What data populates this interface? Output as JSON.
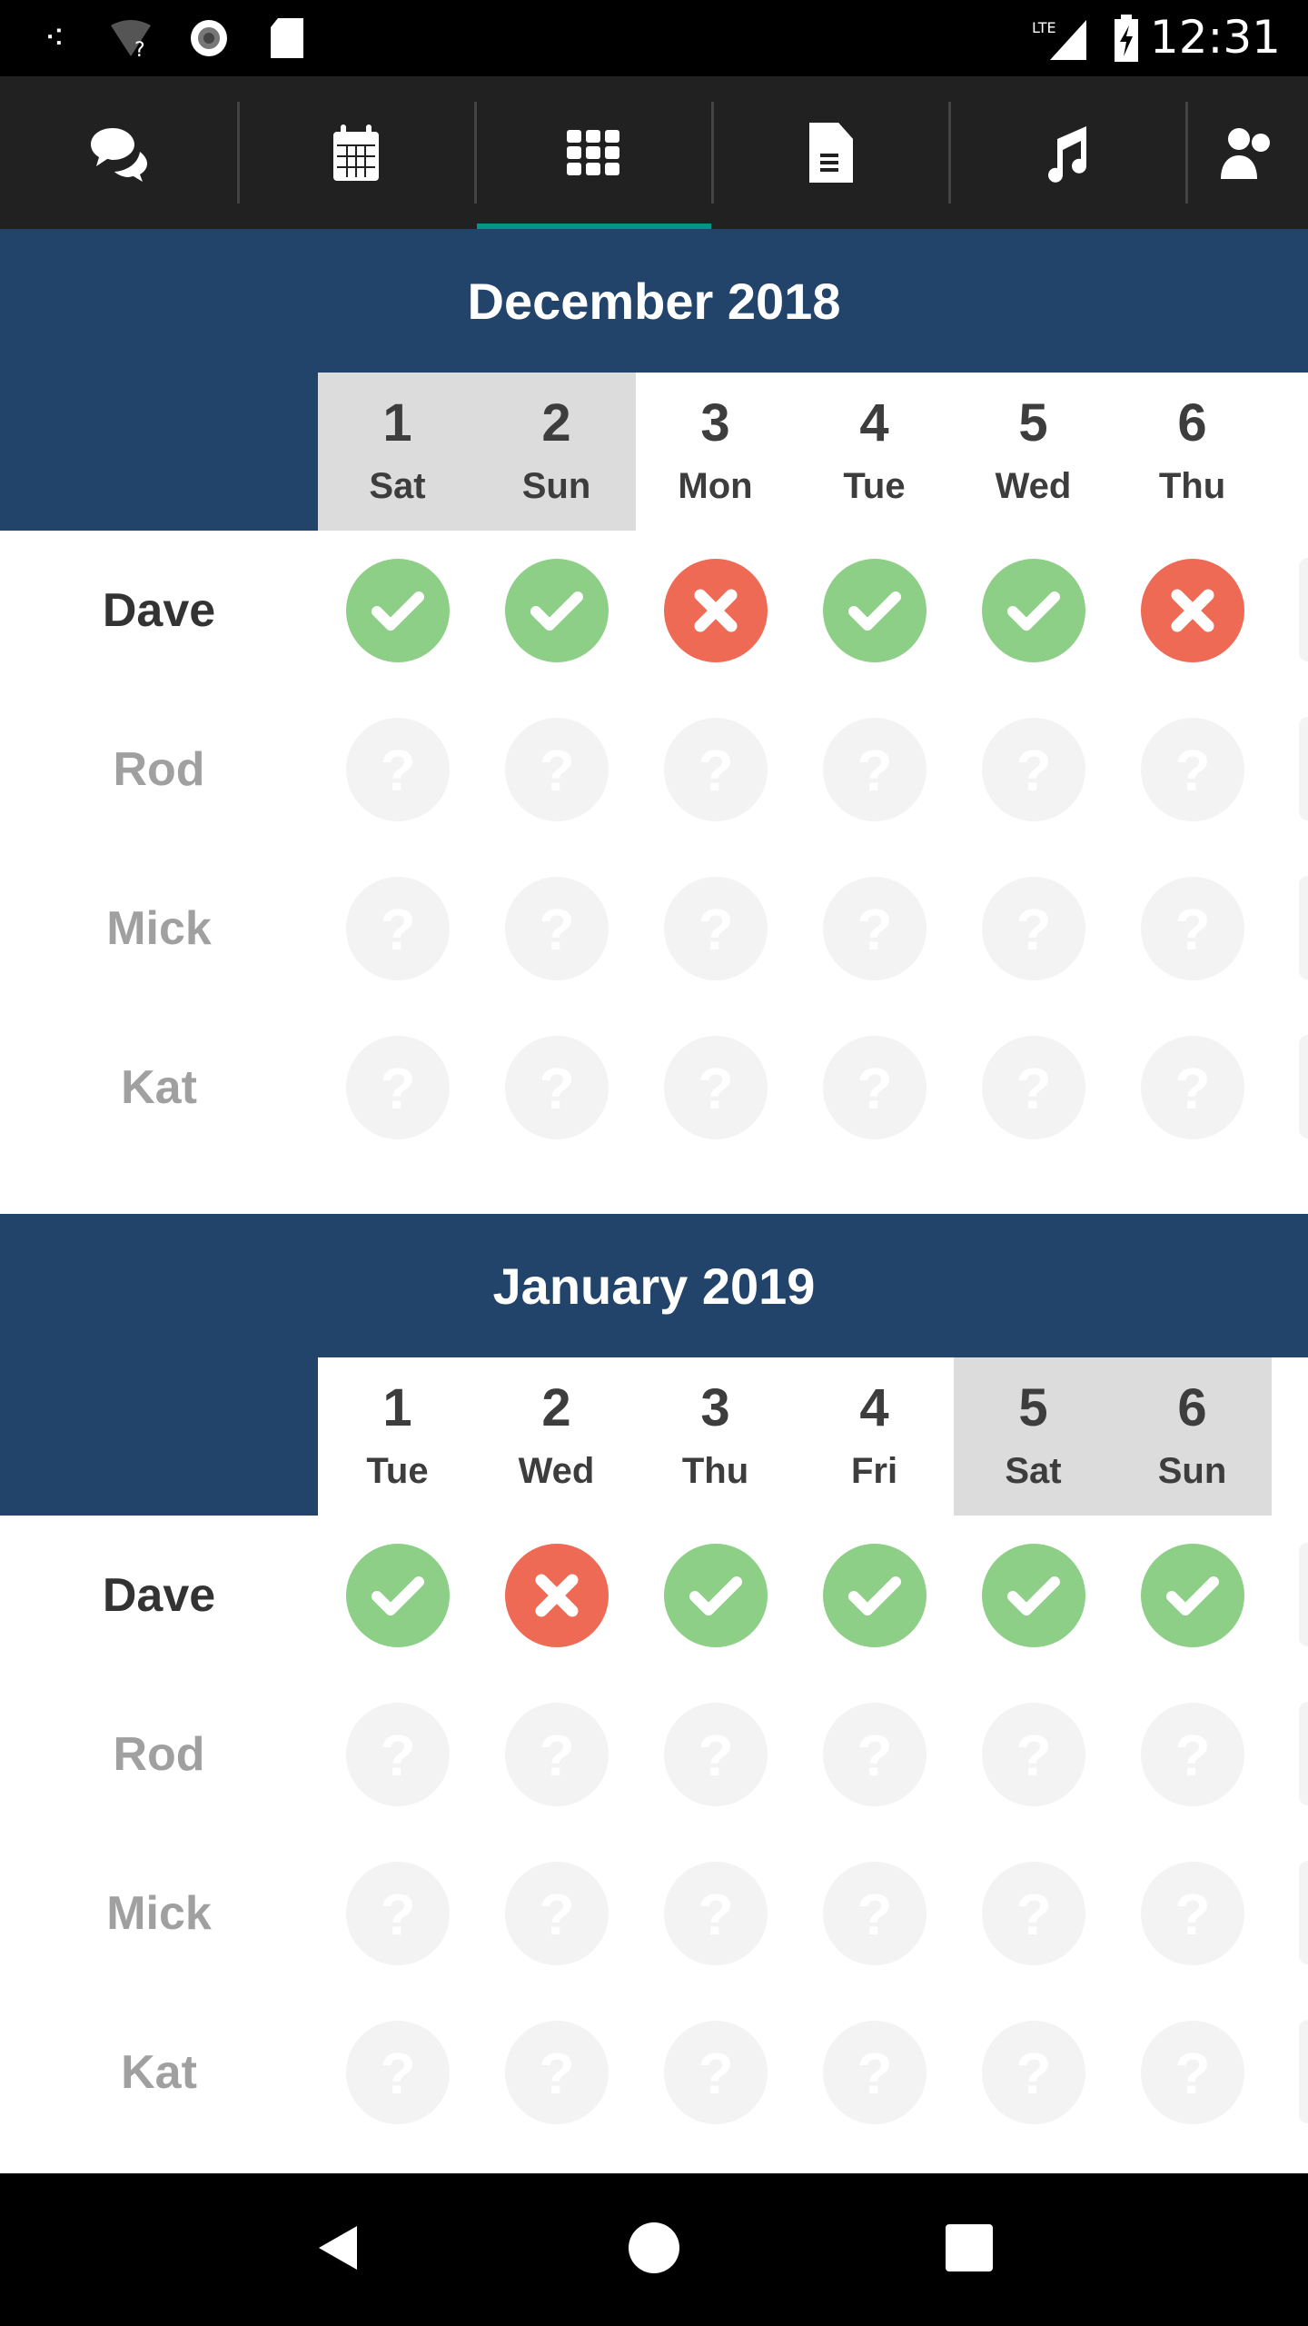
{
  "status_bar": {
    "time": "12:31",
    "network": "LTE",
    "icons": [
      "assistant-icon",
      "wifi-unknown-icon",
      "sync-icon",
      "sd-card-icon",
      "signal-icon",
      "battery-charging-icon"
    ]
  },
  "tabs": [
    {
      "icon": "chat-icon",
      "active": false
    },
    {
      "icon": "calendar-icon",
      "active": false
    },
    {
      "icon": "grid-icon",
      "active": true
    },
    {
      "icon": "document-icon",
      "active": false
    },
    {
      "icon": "music-icon",
      "active": false
    },
    {
      "icon": "people-icon",
      "active": false
    }
  ],
  "colors": {
    "header": "#23446a",
    "yes": "#8dcf86",
    "no": "#ef6a55",
    "unknown": "#f3f3f3",
    "accent": "#009688"
  },
  "months": [
    {
      "title": "December 2018",
      "days": [
        {
          "num": "1",
          "wd": "Sat",
          "weekend": true
        },
        {
          "num": "2",
          "wd": "Sun",
          "weekend": true
        },
        {
          "num": "3",
          "wd": "Mon"
        },
        {
          "num": "4",
          "wd": "Tue"
        },
        {
          "num": "5",
          "wd": "Wed"
        },
        {
          "num": "6",
          "wd": "Thu"
        }
      ],
      "people": [
        {
          "name": "Dave",
          "current": true,
          "status": [
            "yes",
            "yes",
            "no",
            "yes",
            "yes",
            "no"
          ]
        },
        {
          "name": "Rod",
          "status": [
            "unknown",
            "unknown",
            "unknown",
            "unknown",
            "unknown",
            "unknown"
          ]
        },
        {
          "name": "Mick",
          "status": [
            "unknown",
            "unknown",
            "unknown",
            "unknown",
            "unknown",
            "unknown"
          ]
        },
        {
          "name": "Kat",
          "status": [
            "unknown",
            "unknown",
            "unknown",
            "unknown",
            "unknown",
            "unknown"
          ]
        }
      ]
    },
    {
      "title": "January 2019",
      "days": [
        {
          "num": "1",
          "wd": "Tue"
        },
        {
          "num": "2",
          "wd": "Wed"
        },
        {
          "num": "3",
          "wd": "Thu"
        },
        {
          "num": "4",
          "wd": "Fri"
        },
        {
          "num": "5",
          "wd": "Sat",
          "weekend": true
        },
        {
          "num": "6",
          "wd": "Sun",
          "weekend": true
        }
      ],
      "people": [
        {
          "name": "Dave",
          "current": true,
          "status": [
            "yes",
            "no",
            "yes",
            "yes",
            "yes",
            "yes"
          ]
        },
        {
          "name": "Rod",
          "status": [
            "unknown",
            "unknown",
            "unknown",
            "unknown",
            "unknown",
            "unknown"
          ]
        },
        {
          "name": "Mick",
          "status": [
            "unknown",
            "unknown",
            "unknown",
            "unknown",
            "unknown",
            "unknown"
          ]
        },
        {
          "name": "Kat",
          "status": [
            "unknown",
            "unknown",
            "unknown",
            "unknown",
            "unknown",
            "unknown"
          ]
        }
      ]
    }
  ],
  "nav": [
    "back-icon",
    "home-icon",
    "recents-icon"
  ]
}
